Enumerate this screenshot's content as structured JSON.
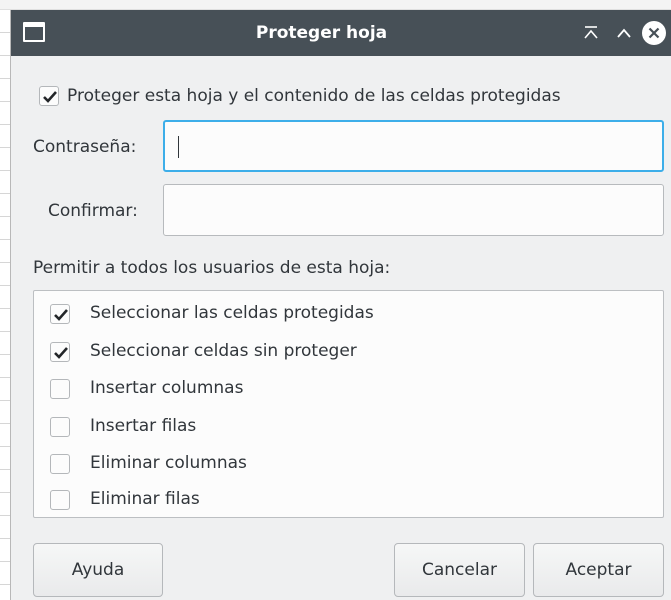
{
  "window": {
    "title": "Proteger hoja"
  },
  "protect": {
    "label": "Proteger esta hoja y el contenido de las celdas protegidas",
    "checked": true
  },
  "password": {
    "label": "Contraseña:",
    "value": ""
  },
  "confirm": {
    "label": "Confirmar:",
    "value": ""
  },
  "permissions": {
    "heading": "Permitir a todos los usuarios de esta hoja:",
    "items": [
      {
        "label": "Seleccionar las celdas protegidas",
        "checked": true
      },
      {
        "label": "Seleccionar celdas sin proteger",
        "checked": true
      },
      {
        "label": "Insertar columnas",
        "checked": false
      },
      {
        "label": "Insertar filas",
        "checked": false
      },
      {
        "label": "Eliminar columnas",
        "checked": false
      },
      {
        "label": "Eliminar filas",
        "checked": false
      }
    ]
  },
  "buttons": {
    "help": "Ayuda",
    "cancel": "Cancelar",
    "ok": "Aceptar"
  },
  "colors": {
    "titlebar": "#475057",
    "focus": "#3daee9",
    "dialog_bg": "#eff0f1"
  },
  "icons": {
    "app": "window-icon",
    "keep_above": "keep-above-icon",
    "minimize": "chevron-up-icon",
    "close": "close-icon",
    "check": "checkmark-icon"
  }
}
